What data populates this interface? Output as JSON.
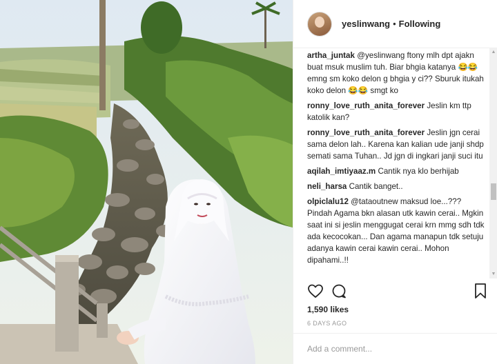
{
  "header": {
    "username": "yeslinwang",
    "separator": "•",
    "follow_label": "Following"
  },
  "comments": [
    {
      "user": "artha_juntak",
      "text": "@yeslinwang ftony mlh dpt ajakn buat msuk muslim tuh. Biar bhgia katanya 😂😂 emng sm koko delon g bhgia y ci?? Sburuk itukah koko delon 😂😂 smgt ko"
    },
    {
      "user": "ronny_love_ruth_anita_forever",
      "text": "Jeslin km ttp katolik kan?"
    },
    {
      "user": "ronny_love_ruth_anita_forever",
      "text": "Jeslin jgn cerai sama delon lah.. Karena kan kalian ude janji shdp semati sama Tuhan.. Jd jgn di ingkari janji suci itu"
    },
    {
      "user": "aqilah_imtiyaaz.m",
      "text": "Cantik nya klo berhijab"
    },
    {
      "user": "neli_harsa",
      "text": "Cantik banget.."
    },
    {
      "user": "olpiclalu12",
      "text": "@tataoutnew maksud loe...??? Pindah Agama bkn alasan utk kawin cerai.. Mgkin saat ini si jeslin menggugat cerai krn mmg sdh tdk ada kecocokan... Dan agama manapun tdk setuju adanya kawin cerai kawin cerai.. Mohon dipahami..!!"
    }
  ],
  "actions": {
    "like_icon": "heart-icon",
    "comment_icon": "speech-bubble-icon",
    "save_icon": "bookmark-icon"
  },
  "likes": "1,590 likes",
  "timestamp": "6 DAYS AGO",
  "add_comment_placeholder": "Add a comment...",
  "colors": {
    "text": "#262626",
    "muted": "#999999",
    "border": "#efefef"
  }
}
